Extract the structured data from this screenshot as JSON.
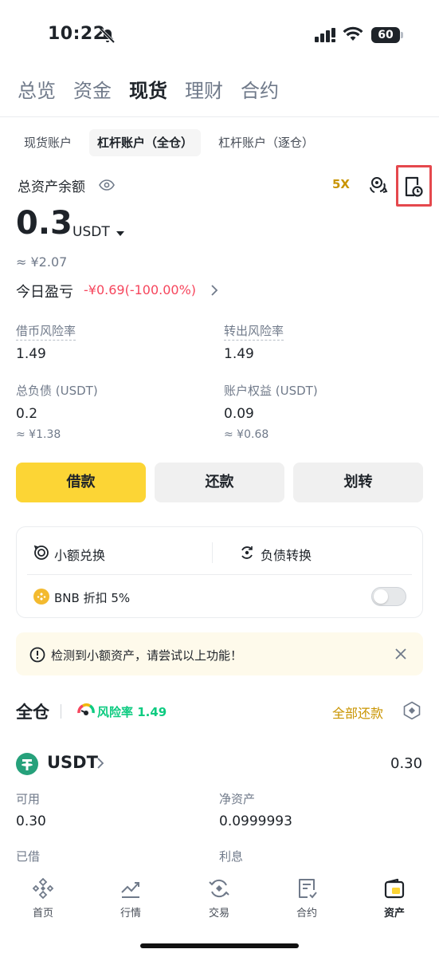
{
  "status_bar": {
    "time": "10:22",
    "battery": "60"
  },
  "main_tabs": [
    "总览",
    "资金",
    "现货",
    "理财",
    "合约"
  ],
  "sub_tabs": [
    "现货账户",
    "杠杆账户（全仓）",
    "杠杆账户（逐仓）"
  ],
  "asset": {
    "label": "总资产余额",
    "leverage": "5X",
    "value": "0.3",
    "unit": "USDT",
    "cny": "≈ ¥2.07",
    "pnl_label": "今日盈亏",
    "pnl_value": "-¥0.69(-100.00%)"
  },
  "stats": {
    "borrow_risk_label": "借币风险率",
    "borrow_risk_value": "1.49",
    "transfer_risk_label": "转出风险率",
    "transfer_risk_value": "1.49",
    "total_debt_label": "总负债 (USDT)",
    "total_debt_value": "0.2",
    "total_debt_cny": "≈ ¥1.38",
    "equity_label": "账户权益 (USDT)",
    "equity_value": "0.09",
    "equity_cny": "≈ ¥0.68"
  },
  "actions": {
    "borrow": "借款",
    "repay": "还款",
    "transfer": "划转"
  },
  "tools": {
    "small_exchange": "小额兑换",
    "debt_convert": "负债转换",
    "bnb_discount": "BNB 折扣 5%",
    "bnb_toggle_on": false
  },
  "alert": {
    "text": "检测到小额资产，请尝试以上功能！"
  },
  "cross": {
    "title": "全仓",
    "risk": "风险率 1.49",
    "repay_all": "全部还款"
  },
  "coin": {
    "name": "USDT",
    "total": "0.30",
    "available_label": "可用",
    "available_value": "0.30",
    "net_label": "净资产",
    "net_value": "0.0999993",
    "borrowed_label": "已借",
    "interest_label": "利息"
  },
  "bottom_nav": [
    "首页",
    "行情",
    "交易",
    "合约",
    "资产"
  ],
  "colors": {
    "accent": "#FCD535",
    "positive": "#0ECB81",
    "negative": "#F6465D",
    "gold_text": "#C99400",
    "highlight_box": "#E5484D"
  }
}
